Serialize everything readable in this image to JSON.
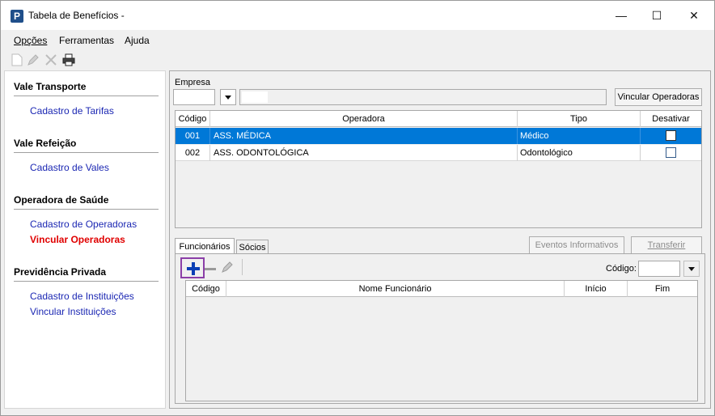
{
  "window": {
    "title": "Tabela de Benefícios -",
    "app_icon_letter": "P",
    "minimize": "—",
    "maximize": "☐",
    "close": "✕"
  },
  "menu": {
    "items": [
      {
        "label": "Opções"
      },
      {
        "label": "Ferramentas"
      },
      {
        "label": "Ajuda"
      }
    ]
  },
  "toolbar": {
    "icons": [
      "new-document-icon",
      "edit-pencil-icon",
      "delete-x-icon",
      "print-icon"
    ]
  },
  "sidebar": {
    "sections": [
      {
        "heading": "Vale Transporte",
        "links": [
          {
            "label": "Cadastro de Tarifas",
            "active": false
          }
        ]
      },
      {
        "heading": "Vale Refeição",
        "links": [
          {
            "label": "Cadastro de Vales",
            "active": false
          }
        ]
      },
      {
        "heading": "Operadora de Saúde",
        "links": [
          {
            "label": "Cadastro de Operadoras",
            "active": false
          },
          {
            "label": "Vincular Operadoras",
            "active": true
          }
        ]
      },
      {
        "heading": "Previdência Privada",
        "links": [
          {
            "label": "Cadastro de Instituições",
            "active": false
          },
          {
            "label": "Vincular Instituições",
            "active": false
          }
        ]
      }
    ]
  },
  "empresa": {
    "label": "Empresa",
    "code_value": "",
    "name_value": "",
    "vincular_button": "Vincular Operadoras"
  },
  "operadoras_table": {
    "headers": [
      "Código",
      "Operadora",
      "Tipo",
      "Desativar"
    ],
    "rows": [
      {
        "codigo": "001",
        "operadora": "ASS. MÉDICA",
        "tipo": "Médico",
        "desativar": false,
        "selected": true
      },
      {
        "codigo": "002",
        "operadora": "ASS. ODONTOLÓGICA",
        "tipo": "Odontológico",
        "desativar": false,
        "selected": false
      }
    ]
  },
  "tabs": {
    "items": [
      {
        "label": "Funcionários",
        "active": true
      },
      {
        "label": "Sócios",
        "active": false
      }
    ],
    "eventos_button": "Eventos Informativos",
    "transferir_button": "Transferir"
  },
  "funcionarios": {
    "codigo_label": "Código:",
    "codigo_value": "",
    "headers": [
      "Código",
      "Nome Funcionário",
      "Início",
      "Fim"
    ]
  },
  "colors": {
    "selection": "#0078d7",
    "link": "#1b27b3",
    "active_link": "#e00000",
    "highlight_border": "#8b3fa8",
    "plus": "#0a3fb5"
  }
}
